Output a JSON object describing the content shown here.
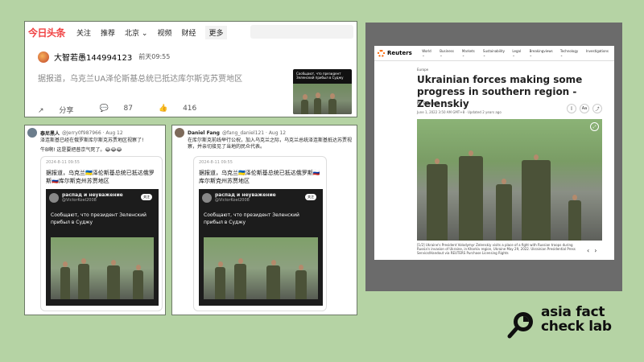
{
  "toutiao": {
    "logo": "今日头条",
    "nav": [
      "关注",
      "推荐",
      "北京 ⌄",
      "视频",
      "财经",
      "更多"
    ],
    "author": "大智若愚144994123",
    "time": "前天09:55",
    "text": "据报道，乌克兰UA泽伦斯基总统已抵达库尔斯克苏贾地区",
    "thumb_caption": "Сообщают, что президент Зеленский прибыл в Суджу",
    "share": "分享",
    "comments": "87",
    "likes": "416"
  },
  "tweet1": {
    "name": "泰尼黑人",
    "handle": "@Jerry0f987966 · Aug 12",
    "body_line1": "泽连斯基已经在俄罗斯库尔斯克苏贾地区视察了!",
    "body_line2": "牛B啊! 这是要把普京气死了。😂😂😂",
    "quote_time": "2024-8-11 09:55",
    "quote_text": "据报道，乌克兰🇺🇦泽伦斯基总统已抵达俄罗斯🇷🇺库尔斯克州苏贾地区",
    "embed_name": "распад и неуважение",
    "embed_handle": "@VictorKoel2008",
    "embed_follow": "关注",
    "embed_text": "Сообщают, что президент Зеленский прибыл в Суджу"
  },
  "tweet2": {
    "name": "Daniel Fang",
    "handle": "@fang_daniel121 · Aug 12",
    "body_line1": "在库尔斯克前线举行公祝，加入乌克兰之际，乌克兰总统泽连斯基抵达苏贾视",
    "body_line2": "察，并亲切接见了当地的民众代表。",
    "quote_time": "2024-8-11 09:55",
    "quote_text": "据报道，乌克兰🇺🇦泽伦斯基总统已抵达俄罗斯🇷🇺库尔斯克州苏贾地区",
    "embed_name": "распад и неуважение",
    "embed_handle": "@VictorKoel2008",
    "embed_follow": "关注",
    "embed_text": "Сообщают, что президент Зеленский прибыл в Суджу"
  },
  "reuters": {
    "logo": "Reuters",
    "menu": [
      "World ⌄",
      "Business ⌄",
      "Markets ⌄",
      "Sustainability ⌄",
      "Legal ⌄",
      "Breakingviews ⌄",
      "Technology ⌄",
      "Investigations"
    ],
    "section": "Europe",
    "title": "Ukrainian forces making some progress in southern region -Zelenskiy",
    "byline": "By Reuters",
    "date": "June 1, 2022 3:50 AM GMT+8 · Updated 2 years ago",
    "caption": "[1/2] Ukraine's President Volodymyr Zelenskiy visits a place of a fight with Russian troops during Russia's invasion of Ukraine, in Kharkiv region, Ukraine May 29, 2022. Ukrainian Presidential Press Service/Handout via REUTERS Purchase Licensing Rights"
  },
  "logo": {
    "line1": "asia fact",
    "line2": "check lab"
  }
}
